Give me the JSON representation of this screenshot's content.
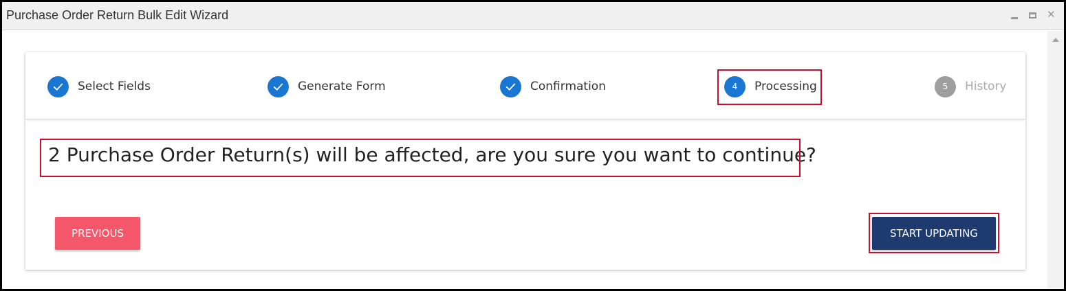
{
  "window": {
    "title": "Purchase Order Return Bulk Edit Wizard",
    "controls": [
      "minimize-icon",
      "maximize-icon",
      "close-icon"
    ]
  },
  "stepper": {
    "steps": [
      {
        "number": "1",
        "label": "Select Fields",
        "state": "completed",
        "icon": "check-icon"
      },
      {
        "number": "2",
        "label": "Generate Form",
        "state": "completed",
        "icon": "check-icon"
      },
      {
        "number": "3",
        "label": "Confirmation",
        "state": "completed",
        "icon": "check-icon"
      },
      {
        "number": "4",
        "label": "Processing",
        "state": "active"
      },
      {
        "number": "5",
        "label": "History",
        "state": "pending"
      }
    ]
  },
  "content": {
    "message": "2 Purchase Order Return(s) will be affected, are you sure you want to continue?"
  },
  "actions": {
    "previous_label": "PREVIOUS",
    "start_label": "START UPDATING"
  },
  "colors": {
    "step_active": "#1976d2",
    "step_pending": "#9e9e9e",
    "previous_button": "#f4566a",
    "start_button": "#1f3a6e",
    "highlight": "#c8102e"
  }
}
